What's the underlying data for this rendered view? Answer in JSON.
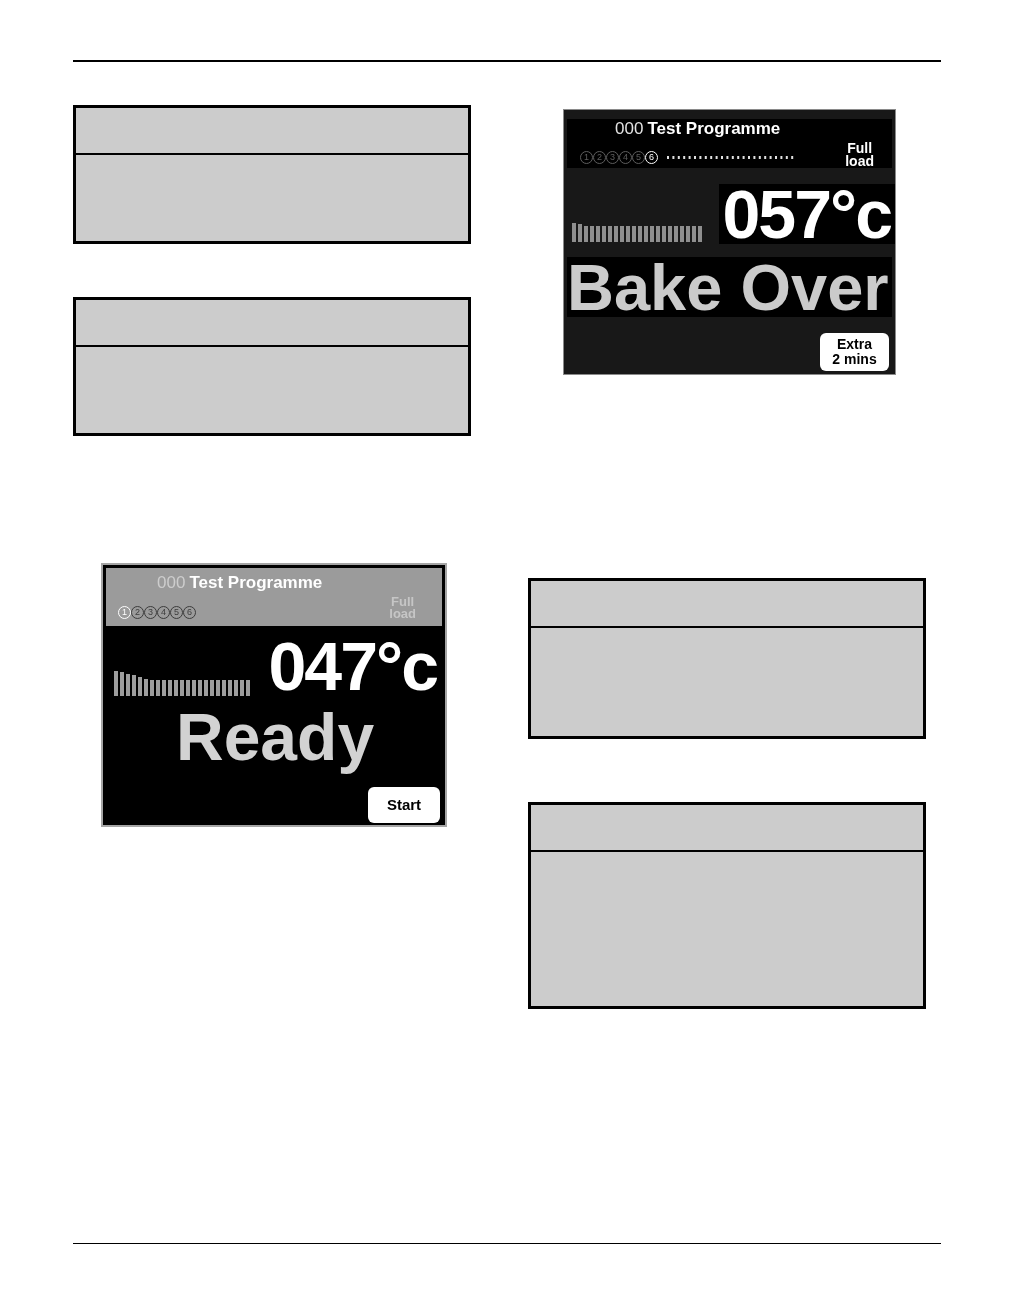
{
  "screens": [
    {
      "kind": "ready",
      "header": {
        "dimmed": true,
        "program_number": "000",
        "program_name": "Test Programme",
        "load": "Full load"
      },
      "steps": [
        {
          "label": "1",
          "selected": true
        },
        {
          "label": "2",
          "selected": false
        },
        {
          "label": "3",
          "selected": false
        },
        {
          "label": "4",
          "selected": false
        },
        {
          "label": "5",
          "selected": false
        },
        {
          "label": "6",
          "selected": false
        }
      ],
      "temperature": "047°c",
      "status": "Ready",
      "button": {
        "label": "Start"
      }
    },
    {
      "kind": "bake-over",
      "header": {
        "dimmed": false,
        "program_number": "000",
        "program_name": "Test Programme",
        "load": "Full load"
      },
      "steps": [
        {
          "label": "1",
          "selected": false
        },
        {
          "label": "2",
          "selected": false
        },
        {
          "label": "3",
          "selected": false
        },
        {
          "label": "4",
          "selected": false
        },
        {
          "label": "5",
          "selected": false
        },
        {
          "label": "6",
          "selected": true
        }
      ],
      "temperature": "057°c",
      "status": "Bake Over",
      "button": {
        "label": "Extra 2 mins"
      }
    }
  ]
}
